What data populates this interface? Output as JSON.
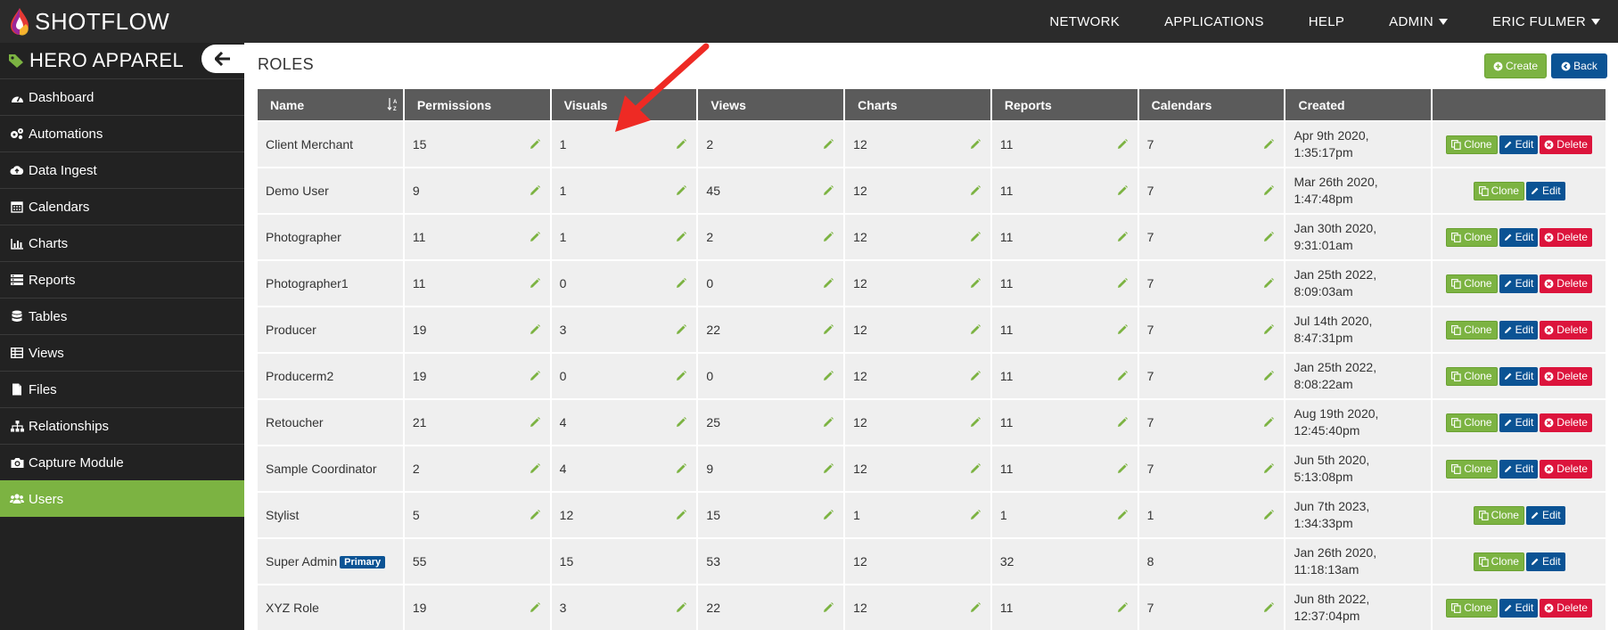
{
  "app": {
    "logo_shot": "SHOT",
    "logo_flow": "FLOW"
  },
  "nav": {
    "network": "NETWORK",
    "applications": "APPLICATIONS",
    "help": "HELP",
    "admin": "ADMIN",
    "user": "ERIC FULMER"
  },
  "sidebar": {
    "brand": "HERO APPAREL",
    "items": [
      {
        "label": "Dashboard",
        "icon": "dashboard-icon"
      },
      {
        "label": "Automations",
        "icon": "cogs-icon"
      },
      {
        "label": "Data Ingest",
        "icon": "cloud-upload-icon"
      },
      {
        "label": "Calendars",
        "icon": "calendar-icon"
      },
      {
        "label": "Charts",
        "icon": "bar-chart-icon"
      },
      {
        "label": "Reports",
        "icon": "list-icon"
      },
      {
        "label": "Tables",
        "icon": "database-icon"
      },
      {
        "label": "Views",
        "icon": "table-icon"
      },
      {
        "label": "Files",
        "icon": "file-icon"
      },
      {
        "label": "Relationships",
        "icon": "sitemap-icon"
      },
      {
        "label": "Capture Module",
        "icon": "camera-icon"
      },
      {
        "label": "Users",
        "icon": "users-icon"
      }
    ],
    "active": "Users"
  },
  "main": {
    "title": "ROLES",
    "create_label": "Create",
    "back_label": "Back",
    "columns": [
      "Name",
      "Permissions",
      "Visuals",
      "Views",
      "Charts",
      "Reports",
      "Calendars",
      "Created",
      ""
    ],
    "action_labels": {
      "clone": "Clone",
      "edit": "Edit",
      "delete": "Delete"
    },
    "primary_badge": "Primary",
    "rows": [
      {
        "name": "Client Merchant",
        "permissions": "15",
        "visuals": "1",
        "views": "2",
        "charts": "12",
        "reports": "11",
        "calendars": "7",
        "created_date": "Apr 9th 2020,",
        "created_time": "1:35:17pm"
      },
      {
        "name": "Demo User",
        "permissions": "9",
        "visuals": "1",
        "views": "45",
        "charts": "12",
        "reports": "11",
        "calendars": "7",
        "created_date": "Mar 26th 2020,",
        "created_time": "1:47:48pm"
      },
      {
        "name": "Photographer",
        "permissions": "11",
        "visuals": "1",
        "views": "2",
        "charts": "12",
        "reports": "11",
        "calendars": "7",
        "created_date": "Jan 30th 2020,",
        "created_time": "9:31:01am"
      },
      {
        "name": "Photographer1",
        "permissions": "11",
        "visuals": "0",
        "views": "0",
        "charts": "12",
        "reports": "11",
        "calendars": "7",
        "created_date": "Jan 25th 2022,",
        "created_time": "8:09:03am"
      },
      {
        "name": "Producer",
        "permissions": "19",
        "visuals": "3",
        "views": "22",
        "charts": "12",
        "reports": "11",
        "calendars": "7",
        "created_date": "Jul 14th 2020,",
        "created_time": "8:47:31pm"
      },
      {
        "name": "Producerm2",
        "permissions": "19",
        "visuals": "0",
        "views": "0",
        "charts": "12",
        "reports": "11",
        "calendars": "7",
        "created_date": "Jan 25th 2022,",
        "created_time": "8:08:22am"
      },
      {
        "name": "Retoucher",
        "permissions": "21",
        "visuals": "4",
        "views": "25",
        "charts": "12",
        "reports": "11",
        "calendars": "7",
        "created_date": "Aug 19th 2020,",
        "created_time": "12:45:40pm"
      },
      {
        "name": "Sample Coordinator",
        "permissions": "2",
        "visuals": "4",
        "views": "9",
        "charts": "12",
        "reports": "11",
        "calendars": "7",
        "created_date": "Jun 5th 2020,",
        "created_time": "5:13:08pm"
      },
      {
        "name": "Stylist",
        "permissions": "5",
        "visuals": "12",
        "views": "15",
        "charts": "1",
        "reports": "1",
        "calendars": "1",
        "created_date": "Jun 7th 2023,",
        "created_time": "1:34:33pm"
      },
      {
        "name": "Super Admin",
        "permissions": "55",
        "visuals": "15",
        "views": "53",
        "charts": "12",
        "reports": "32",
        "calendars": "8",
        "created_date": "Jan 26th 2020,",
        "created_time": "11:18:13am"
      },
      {
        "name": "XYZ Role",
        "permissions": "19",
        "visuals": "3",
        "views": "22",
        "charts": "12",
        "reports": "11",
        "calendars": "7",
        "created_date": "Jun 8th 2022,",
        "created_time": "12:37:04pm"
      }
    ]
  },
  "colors": {
    "topbar": "#2b2b2b",
    "sidebar": "#222222",
    "accent_green": "#7cb342",
    "primary_blue": "#0b5394",
    "danger_red": "#dc143c",
    "header_gray": "#5b5b5b",
    "annotation_arrow": "#ee2a24"
  }
}
